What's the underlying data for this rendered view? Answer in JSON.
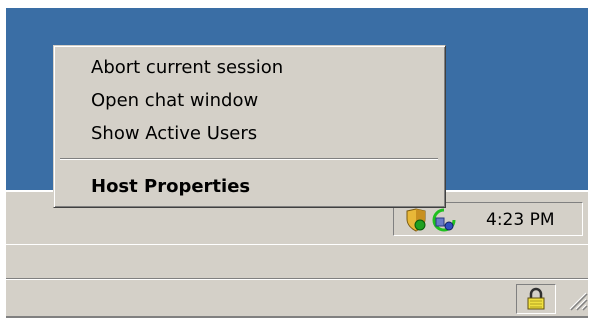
{
  "context_menu": {
    "items": [
      {
        "label": "Abort current session",
        "bold": false
      },
      {
        "label": "Open chat window",
        "bold": false
      },
      {
        "label": "Show Active Users",
        "bold": false
      },
      {
        "label": "Host Properties",
        "bold": true
      }
    ]
  },
  "tray": {
    "clock": "4:23 PM",
    "icons": [
      "shield-icon",
      "connection-status-icon"
    ]
  },
  "statusbar": {
    "icons": [
      "padlock-icon",
      "resize-grip-icon"
    ]
  },
  "colors": {
    "desktop": "#3a6ea5",
    "face": "#d4d0c8"
  }
}
